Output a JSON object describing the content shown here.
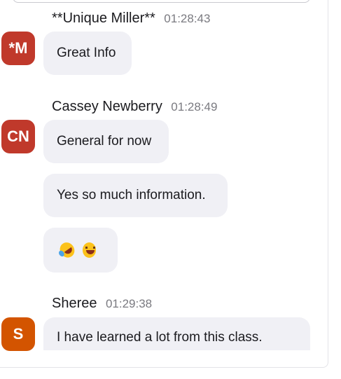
{
  "messages": [
    {
      "sender": "**Unique Miller**",
      "initials": "*M",
      "avatar_color": "#c0392b",
      "time": "01:28:43",
      "bubbles": [
        "Great Info"
      ]
    },
    {
      "sender": "Cassey Newberry",
      "initials": "CN",
      "avatar_color": "#c0392b",
      "time": "01:28:49",
      "bubbles": [
        "General for now",
        "Yes so much information."
      ],
      "reactions": [
        "rolling-on-floor-laughing-emoji",
        "grinning-squinting-face-emoji"
      ]
    },
    {
      "sender": "Sheree",
      "initials": "S",
      "avatar_color": "#d35400",
      "time": "01:29:38",
      "bubbles": [
        "I have learned a lot from this class."
      ]
    }
  ]
}
